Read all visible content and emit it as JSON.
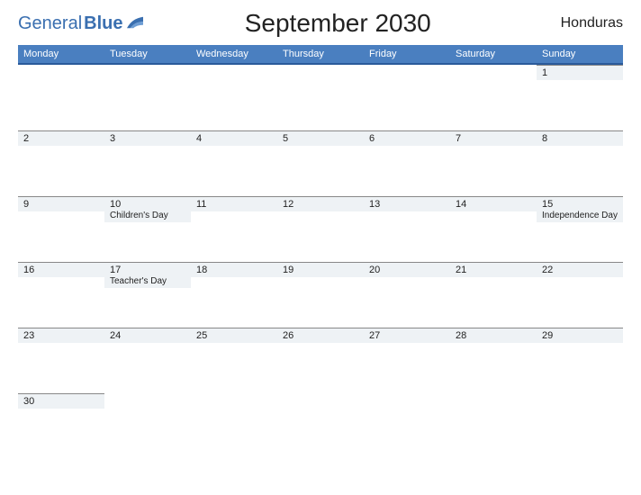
{
  "logo": {
    "general": "General",
    "blue": "Blue"
  },
  "title": "September 2030",
  "country": "Honduras",
  "weekdays": [
    "Monday",
    "Tuesday",
    "Wednesday",
    "Thursday",
    "Friday",
    "Saturday",
    "Sunday"
  ],
  "weeks": [
    [
      {
        "n": "",
        "e": ""
      },
      {
        "n": "",
        "e": ""
      },
      {
        "n": "",
        "e": ""
      },
      {
        "n": "",
        "e": ""
      },
      {
        "n": "",
        "e": ""
      },
      {
        "n": "",
        "e": ""
      },
      {
        "n": "1",
        "e": ""
      }
    ],
    [
      {
        "n": "2",
        "e": ""
      },
      {
        "n": "3",
        "e": ""
      },
      {
        "n": "4",
        "e": ""
      },
      {
        "n": "5",
        "e": ""
      },
      {
        "n": "6",
        "e": ""
      },
      {
        "n": "7",
        "e": ""
      },
      {
        "n": "8",
        "e": ""
      }
    ],
    [
      {
        "n": "9",
        "e": ""
      },
      {
        "n": "10",
        "e": "Children's Day"
      },
      {
        "n": "11",
        "e": ""
      },
      {
        "n": "12",
        "e": ""
      },
      {
        "n": "13",
        "e": ""
      },
      {
        "n": "14",
        "e": ""
      },
      {
        "n": "15",
        "e": "Independence Day"
      }
    ],
    [
      {
        "n": "16",
        "e": ""
      },
      {
        "n": "17",
        "e": "Teacher's Day"
      },
      {
        "n": "18",
        "e": ""
      },
      {
        "n": "19",
        "e": ""
      },
      {
        "n": "20",
        "e": ""
      },
      {
        "n": "21",
        "e": ""
      },
      {
        "n": "22",
        "e": ""
      }
    ],
    [
      {
        "n": "23",
        "e": ""
      },
      {
        "n": "24",
        "e": ""
      },
      {
        "n": "25",
        "e": ""
      },
      {
        "n": "26",
        "e": ""
      },
      {
        "n": "27",
        "e": ""
      },
      {
        "n": "28",
        "e": ""
      },
      {
        "n": "29",
        "e": ""
      }
    ],
    [
      {
        "n": "30",
        "e": ""
      },
      {
        "n": "",
        "e": ""
      },
      {
        "n": "",
        "e": ""
      },
      {
        "n": "",
        "e": ""
      },
      {
        "n": "",
        "e": ""
      },
      {
        "n": "",
        "e": ""
      },
      {
        "n": "",
        "e": ""
      }
    ]
  ]
}
